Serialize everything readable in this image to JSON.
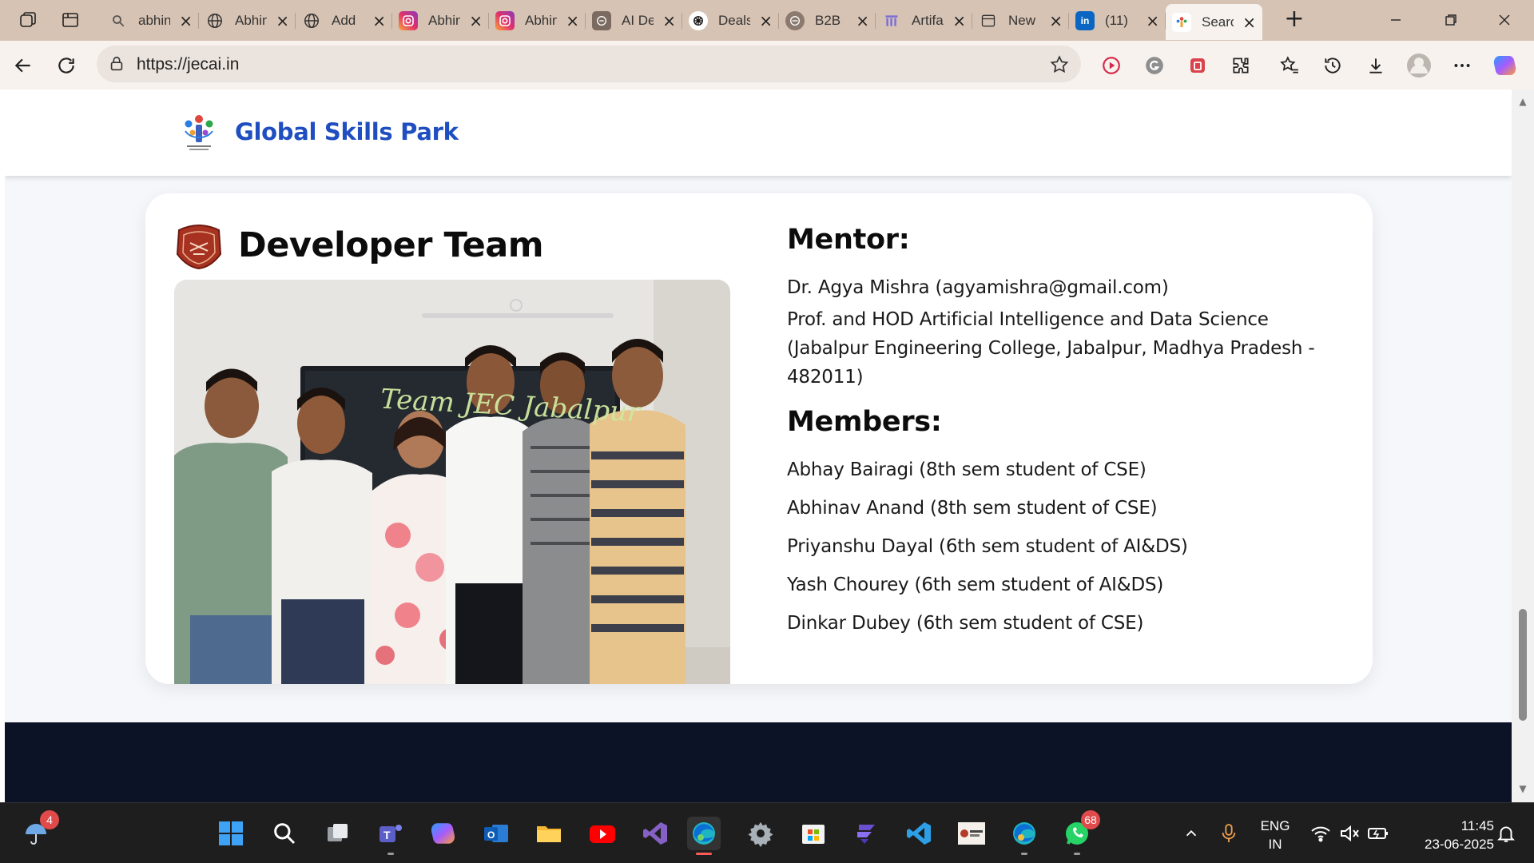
{
  "browser": {
    "tabs": [
      {
        "title": "abhinav",
        "favicon": "search-icon",
        "active": false
      },
      {
        "title": "Abhinav",
        "favicon": "globe-icon",
        "active": false
      },
      {
        "title": "Add",
        "favicon": "globe-icon",
        "active": false
      },
      {
        "title": "Abhinav",
        "favicon": "instagram-icon",
        "active": false
      },
      {
        "title": "Abhinav",
        "favicon": "instagram-icon",
        "active": false
      },
      {
        "title": "AI Dev",
        "favicon": "ai-icon",
        "active": false
      },
      {
        "title": "Deals",
        "favicon": "chatgpt-icon",
        "active": false
      },
      {
        "title": "B2B",
        "favicon": "b2b-icon",
        "active": false
      },
      {
        "title": "Artifact",
        "favicon": "bar-icon",
        "active": false
      },
      {
        "title": "New",
        "favicon": "page-icon",
        "active": false
      },
      {
        "title": "(11)",
        "favicon": "linkedin-icon",
        "active": false
      },
      {
        "title": "Search",
        "favicon": "site-icon",
        "active": true
      }
    ],
    "url": "https://jecai.in"
  },
  "site": {
    "title": "Global Skills Park"
  },
  "team": {
    "heading": "Developer Team",
    "photo_caption": "Team JEC Jabalpur",
    "mentor_title": "Mentor:",
    "mentor_name": "Dr. Agya Mishra (agyamishra@gmail.com)",
    "mentor_role": "Prof. and HOD Artificial Intelligence and Data Science (Jabalpur Engineering College, Jabalpur, Madhya Pradesh - 482011)",
    "members_title": "Members:",
    "members": [
      "Abhay Bairagi (8th sem student of CSE)",
      "Abhinav Anand (8th sem student of CSE)",
      "Priyanshu Dayal (6th sem student of AI&DS)",
      "Yash Chourey (6th sem student of AI&DS)",
      "Dinkar Dubey (6th sem student of CSE)"
    ]
  },
  "taskbar": {
    "weather_badge": "4",
    "whatsapp_badge": "68",
    "language_line1": "ENG",
    "language_line2": "IN",
    "time": "11:45",
    "date": "23-06-2025"
  },
  "colors": {
    "brand_blue": "#1f4ec0",
    "footer_dark": "#0d1326",
    "tab_strip": "#d7c3b3"
  }
}
